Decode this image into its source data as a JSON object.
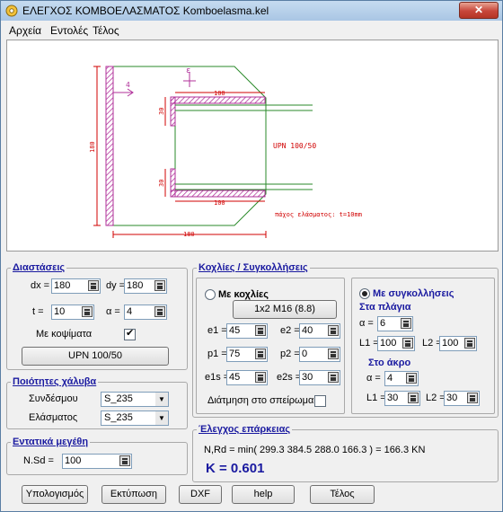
{
  "window": {
    "title": "ΕΛΕΓΧΟΣ ΚΟΜΒΟΕΛΑΣΜΑΤΟΣ  Komboelasma.kel",
    "close": "✕"
  },
  "menu": [
    "Αρχεία",
    "Εντολές",
    "Τέλος"
  ],
  "drawing": {
    "dim_100_top": "100",
    "dim_100_bottom": "100",
    "dim_180_bottom": "180",
    "dim_180_left": "180",
    "dim_30_upper": "30",
    "dim_30_lower": "30",
    "label_4": "4",
    "label_e": "ε",
    "profile": "UPN 100/50",
    "thickness": "πάχος ελάσματος: t=10mm"
  },
  "dimensions": {
    "title": "Διαστάσεις",
    "dx_label": "dx =",
    "dx": "180",
    "dy_label": "dy =",
    "dy": "180",
    "t_label": "t =",
    "t": "10",
    "a_label": "α =",
    "a": "4",
    "cut_label": "Με κοψίματα",
    "profile_button": "UPN 100/50"
  },
  "steel": {
    "title": "Ποιότητες χάλυβα",
    "conn_label": "Συνδέσμου",
    "conn_value": "S_235",
    "plate_label": "Ελάσματος",
    "plate_value": "S_235"
  },
  "forces": {
    "title": "Εντατικά μεγέθη",
    "nsd_label": "N.Sd =",
    "nsd": "100"
  },
  "bolts": {
    "title": "Κοχλίες / Συγκολλήσεις",
    "bolts_radio": "Με κοχλίες",
    "bolt_button": "1x2 M16 (8.8)",
    "e1_label": "e1 =",
    "e1": "45",
    "e2_label": "e2 =",
    "e2": "40",
    "p1_label": "p1 =",
    "p1": "75",
    "p2_label": "p2 =",
    "p2": "0",
    "e1s_label": "e1s =",
    "e1s": "45",
    "e2s_label": "e2s =",
    "e2s": "30",
    "thread_label": "Διάτμηση στο σπείρωμα"
  },
  "welds": {
    "radio": "Με συγκολλήσεις",
    "side_title": "Στα πλάγια",
    "a_label": "α =",
    "a": "6",
    "l1_label": "L1 =",
    "l1": "100",
    "l2_label": "L2 =",
    "l2": "100",
    "end_title": "Στο άκρο",
    "end_a_label": "α =",
    "end_a": "4",
    "end_l1_label": "L1 =",
    "end_l1": "30",
    "end_l2_label": "L2 =",
    "end_l2": "30"
  },
  "check": {
    "title": "Έλεγχος επάρκειας",
    "formula": "N,Rd = min( 299.3  384.5  288.0  166.3 ) = 166.3 KN",
    "result": "K = 0.601"
  },
  "buttons": {
    "calc": "Υπολογισμός",
    "print": "Εκτύπωση",
    "dxf": "DXF",
    "help": "help",
    "exit": "Τέλος"
  },
  "colors": {
    "accent": "#1a1aa0",
    "drawing_green": "#2a8a2a",
    "drawing_red": "#d00000",
    "drawing_magenta": "#b0309a"
  }
}
